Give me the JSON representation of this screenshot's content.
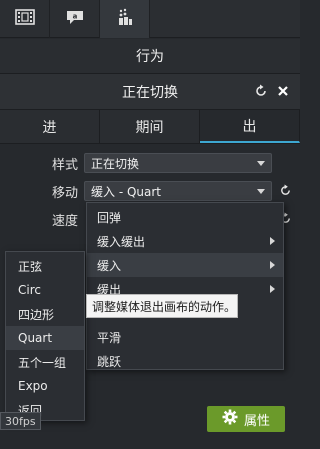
{
  "toolbar": {
    "icons": [
      "film-icon",
      "annotation-icon",
      "behavior-icon"
    ]
  },
  "panel": {
    "section_title": "行为",
    "behavior_name": "正在切换"
  },
  "tabs": [
    {
      "label": "进"
    },
    {
      "label": "期间"
    },
    {
      "label": "出"
    }
  ],
  "form": {
    "style_label": "样式",
    "style_value": "正在切换",
    "move_label": "移动",
    "move_value": "缓入 - Quart",
    "speed_label": "速度"
  },
  "menu": {
    "items": [
      {
        "label": "回弹"
      },
      {
        "label": "缓入缓出"
      },
      {
        "label": "缓入"
      },
      {
        "label": "缓出"
      },
      {
        "label": "平滑"
      },
      {
        "label": "跳跃"
      }
    ]
  },
  "submenu": {
    "items": [
      {
        "label": "正弦"
      },
      {
        "label": "Circ"
      },
      {
        "label": "四边形"
      },
      {
        "label": "Quart"
      },
      {
        "label": "五个一组"
      },
      {
        "label": "Expo"
      },
      {
        "label": "返回"
      }
    ]
  },
  "tooltip": "调整媒体退出画布的动作。",
  "fps_label": "30fps",
  "properties_button": "属性",
  "colors": {
    "accent_blue": "#3da7d1",
    "button_green": "#6b9a2a"
  }
}
